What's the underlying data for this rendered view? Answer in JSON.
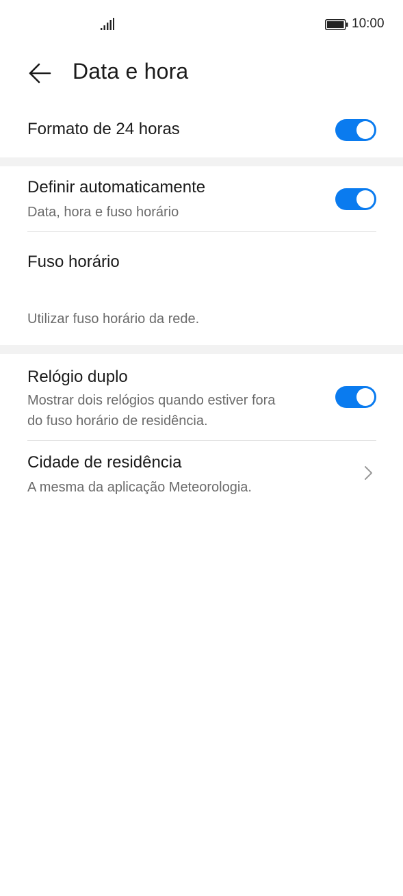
{
  "status_bar": {
    "time": "10:00",
    "signal_icon": "signal-bars-icon",
    "battery_icon": "battery-full-icon"
  },
  "header": {
    "back_icon": "arrow-left-icon",
    "title": "Data e hora"
  },
  "settings": {
    "format24": {
      "title": "Formato de 24 horas",
      "toggle_on": true
    },
    "auto_set": {
      "title": "Definir automaticamente",
      "subtitle": "Data, hora e fuso horário",
      "toggle_on": true
    },
    "timezone": {
      "title": "Fuso horário",
      "note": "Utilizar fuso horário da rede."
    },
    "dual_clock": {
      "title": "Relógio duplo",
      "subtitle_line1": "Mostrar dois relógios quando estiver fora",
      "subtitle_line2": "do fuso horário de residência.",
      "toggle_on": true
    },
    "home_city": {
      "title": "Cidade de residência",
      "subtitle": "A mesma da aplicação Meteorologia.",
      "chevron_icon": "chevron-right-icon"
    }
  },
  "colors": {
    "accent": "#0A7BEF",
    "group_gap": "#F2F2F2",
    "secondary_text": "#6B6B6B"
  }
}
